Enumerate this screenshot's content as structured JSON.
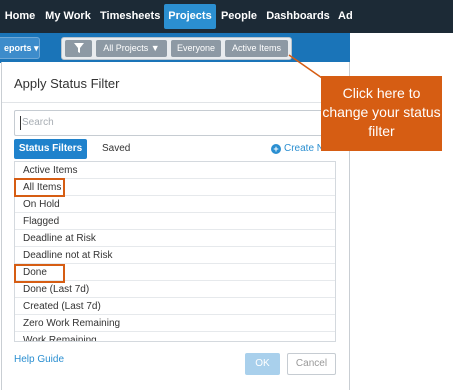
{
  "topnav": {
    "items": [
      {
        "label": "Home"
      },
      {
        "label": "My Work"
      },
      {
        "label": "Timesheets"
      },
      {
        "label": "Projects"
      },
      {
        "label": "People"
      },
      {
        "label": "Dashboards"
      },
      {
        "label": "Ad"
      }
    ],
    "active": "Projects",
    "colors": {
      "bar": "#1c2a36",
      "active": "#2b8fd1"
    }
  },
  "subbar": {
    "reports_label": "eports ▾",
    "filter_icon": "filter-icon",
    "all_projects_label": "All Projects ▼",
    "everyone_label": "Everyone",
    "active_items_label": "Active Items",
    "color": "#1a74b8"
  },
  "dialog": {
    "title": "Apply Status Filter",
    "search_placeholder": "Search",
    "tabs": {
      "status_filters": "Status Filters",
      "saved": "Saved"
    },
    "create_new": "Create New",
    "items": [
      {
        "label": "Active Items"
      },
      {
        "label": "All Items"
      },
      {
        "label": "On Hold"
      },
      {
        "label": "Flagged"
      },
      {
        "label": "Deadline at Risk"
      },
      {
        "label": "Deadline not at Risk"
      },
      {
        "label": "Done"
      },
      {
        "label": "Done (Last 7d)"
      },
      {
        "label": "Created (Last 7d)"
      },
      {
        "label": "Zero Work Remaining"
      },
      {
        "label": "Work Remaining"
      }
    ],
    "highlighted_items": [
      "All Items",
      "Done"
    ],
    "help_guide": "Help Guide",
    "ok_label": "OK",
    "cancel_label": "Cancel"
  },
  "callout": {
    "text": "Click here to change your status filter",
    "color": "#d65d13"
  }
}
